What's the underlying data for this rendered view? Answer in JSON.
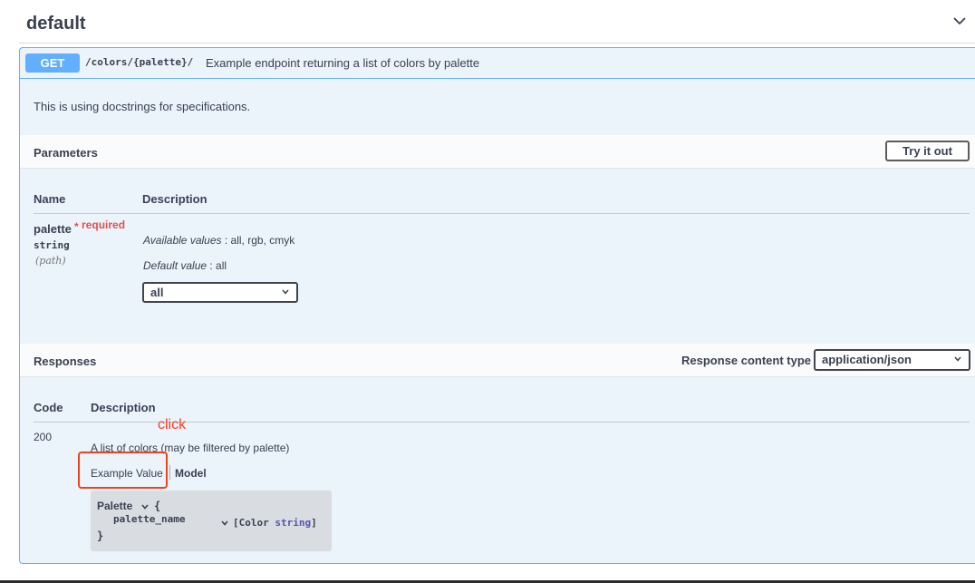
{
  "section": {
    "title": "default"
  },
  "operation": {
    "method": "GET",
    "path": "/colors/{palette}/",
    "summary": "Example endpoint returning a list of colors by palette",
    "description": "This is using docstrings for specifications."
  },
  "parameters": {
    "title": "Parameters",
    "try_button": "Try it out",
    "col_name": "Name",
    "col_description": "Description",
    "items": [
      {
        "name": "palette",
        "required_star": "*",
        "required_label": "required",
        "type": "string",
        "in": "(path)",
        "available_label": "Available values",
        "available_values": " : all, rgb, cmyk",
        "default_label": "Default value",
        "default_value": " : all",
        "selected": "all"
      }
    ]
  },
  "responses": {
    "title": "Responses",
    "content_type_label": "Response content type",
    "content_type": "application/json",
    "col_code": "Code",
    "col_description": "Description",
    "items": [
      {
        "code": "200",
        "description": "A list of colors (may be filtered by palette)",
        "tab_example": "Example Value",
        "tab_model": "Model",
        "model": {
          "title": "Palette",
          "open_brace": "{",
          "property": "palette_name",
          "type_prefix": "[Color ",
          "type_name": "string",
          "type_suffix": "]",
          "close_brace": "}"
        }
      }
    ]
  },
  "annotation": {
    "text": "click",
    "color": "#ff3b1f"
  },
  "colors": {
    "get_badge": "#61affe",
    "opblock_bg": "#ebf3fb",
    "required": "#e05252"
  }
}
